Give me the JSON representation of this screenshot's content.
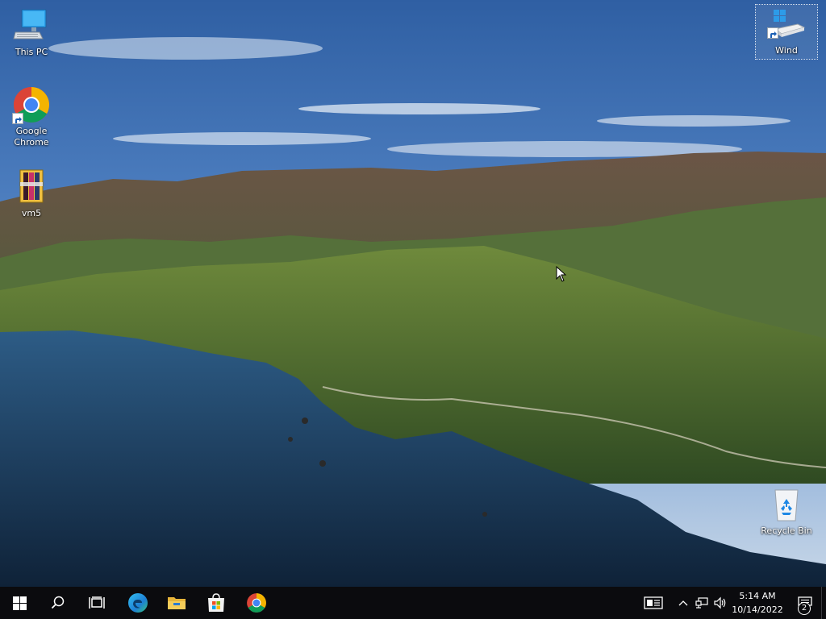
{
  "desktop_icons": [
    {
      "label": "This PC",
      "icon": "monitor-icon"
    },
    {
      "label": "Google Chrome",
      "icon": "chrome-icon"
    },
    {
      "label": "vm5",
      "icon": "archive-icon"
    },
    {
      "label": "Wind",
      "icon": "windows-drive-icon"
    },
    {
      "label": "Recycle Bin",
      "icon": "recycle-bin-icon"
    }
  ],
  "taskbar": {
    "pinned": [
      {
        "name": "start",
        "icon": "windows-logo-icon"
      },
      {
        "name": "search",
        "icon": "search-icon"
      },
      {
        "name": "task-view",
        "icon": "task-view-icon"
      },
      {
        "name": "edge",
        "icon": "edge-icon"
      },
      {
        "name": "file-explorer",
        "icon": "folder-icon"
      },
      {
        "name": "microsoft-store",
        "icon": "store-icon"
      },
      {
        "name": "chrome",
        "icon": "chrome-icon"
      }
    ],
    "tray": {
      "time": "5:14 AM",
      "date": "10/14/2022",
      "notification_count": "2"
    }
  },
  "colors": {
    "taskbar": "#0b0b0e",
    "sky": "#4a80c4",
    "sea": "#1e3a5a",
    "mountain": "#4a6a2e"
  }
}
